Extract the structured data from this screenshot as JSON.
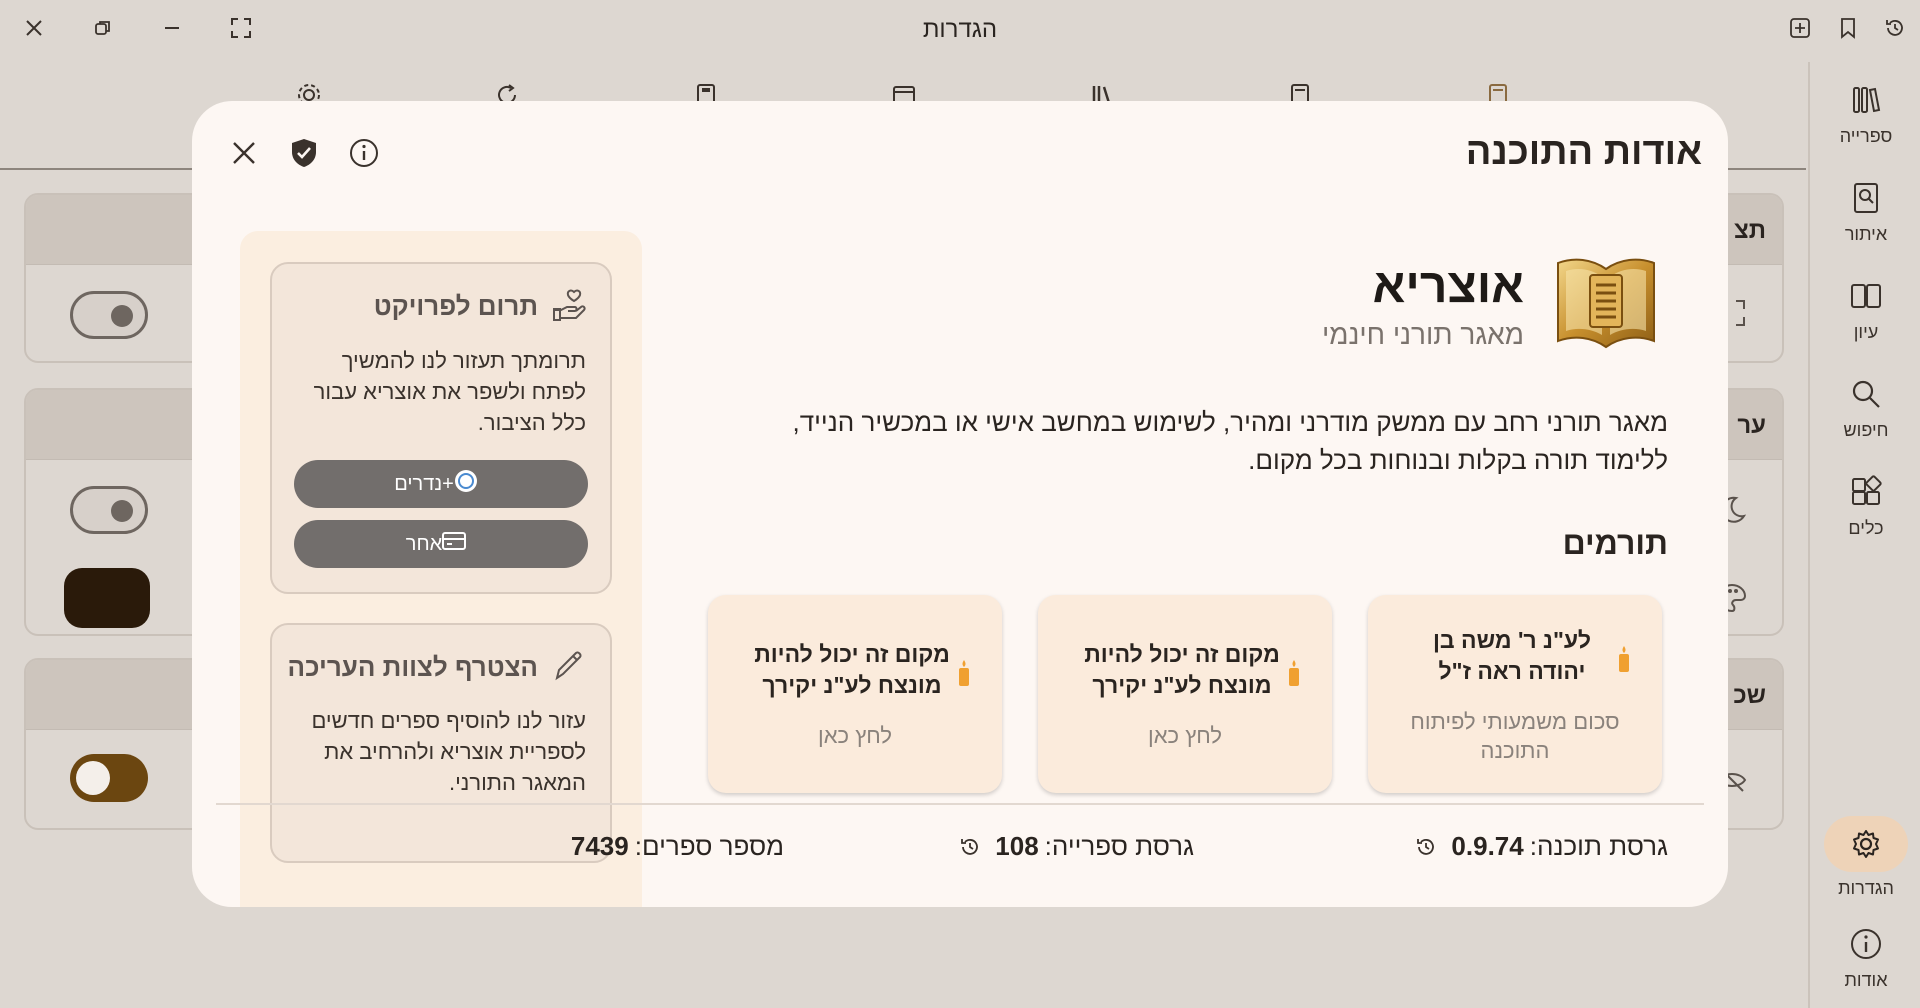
{
  "window": {
    "title": "הגדרות"
  },
  "rail": {
    "items": [
      {
        "label": "ספרייה",
        "icon": "library-icon"
      },
      {
        "label": "איתור",
        "icon": "book-search-icon"
      },
      {
        "label": "עיון",
        "icon": "book-open-icon"
      },
      {
        "label": "חיפוש",
        "icon": "search-icon"
      },
      {
        "label": "כלים",
        "icon": "tools-icon"
      },
      {
        "label": "הגדרות",
        "icon": "gear-icon",
        "active": true
      },
      {
        "label": "אודות",
        "icon": "info-icon"
      }
    ]
  },
  "background": {
    "card_titles": [
      "תצ",
      "ער",
      "שכ"
    ]
  },
  "dialog": {
    "title": "אודות התוכנה",
    "app": {
      "name": "אוצריא",
      "subtitle": "מאגר תורני חינמי",
      "description": "מאגר תורני רחב עם ממשק מודרני ומהיר, לשימוש במחשב אישי או במכשיר הנייד, ללימוד תורה בקלות ובנוחות בכל מקום."
    },
    "support": {
      "donate_title": "תרום לפרויקט",
      "donate_body": "תרומתך תעזור לנו להמשיך לפתח ולשפר את אוצריא עבור כלל הציבור.",
      "buttons": [
        {
          "label": "נדרים+",
          "icon": "nedarim-plus-logo"
        },
        {
          "label": "אחר",
          "icon": "credit-card-icon"
        }
      ],
      "editors_title": "הצטרף לצוות העריכה",
      "editors_body": "עזור לנו להוסיף ספרים חדשים לספריית אוצריא ולהרחיב את המאגר התורני."
    },
    "donors": {
      "title": "תורמים",
      "cards": [
        {
          "name": "לע\"נ ר' משה בן יהודה ראה ז\"ל",
          "sub": "סכום משמעותי לפיתוח התוכנה"
        },
        {
          "name": "מקום זה יכול להיות מונצח לע\"נ יקירך",
          "sub": "לחץ כאן"
        },
        {
          "name": "מקום זה יכול להיות מונצח לע\"נ יקירך",
          "sub": "לחץ כאן"
        }
      ]
    },
    "footer": {
      "app_version_label": "גרסת תוכנה:",
      "app_version": "0.9.74",
      "library_version_label": "גרסת ספרייה:",
      "library_version": "108",
      "books_count_label": "מספר ספרים:",
      "books_count": "7439"
    }
  },
  "colors": {
    "background": "#ddd7d1",
    "dialog": "#fdf7f3",
    "accent": "#6b4610",
    "rail_active": "#eed3b8",
    "button": "#726e6c",
    "candle": "#f0a030"
  }
}
